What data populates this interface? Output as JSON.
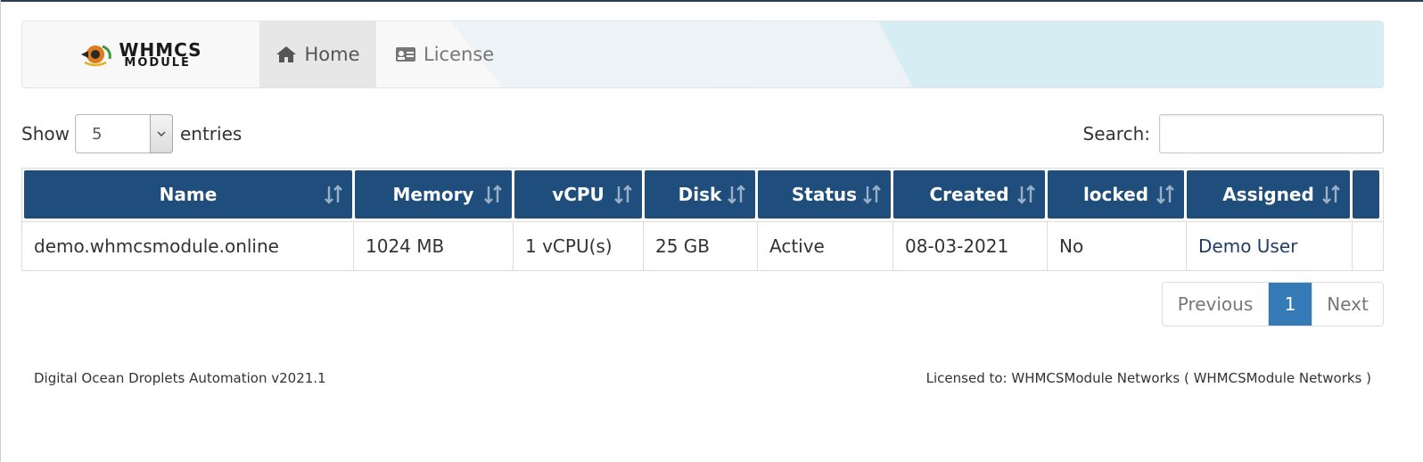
{
  "colors": {
    "header_bg": "#1f4e7d",
    "active_page": "#337ab7",
    "nav_active_bg": "#e7e7e7",
    "nav_accent": "#d6edf3"
  },
  "navbar": {
    "logo_text_top": "WHMCS",
    "logo_text_bottom": "MODULE",
    "items": [
      {
        "label": "Home",
        "icon": "home-icon",
        "active": true
      },
      {
        "label": "License",
        "icon": "id-card-icon",
        "active": false
      }
    ]
  },
  "controls": {
    "show_label": "Show",
    "entries_value": "5",
    "entries_label": "entries",
    "search_label": "Search:",
    "search_value": ""
  },
  "table": {
    "columns": [
      "Name",
      "Memory",
      "vCPU",
      "Disk",
      "Status",
      "Created",
      "locked",
      "Assigned",
      ""
    ],
    "rows": [
      {
        "name": "demo.whmcsmodule.online",
        "memory": "1024 MB",
        "vcpu": "1 vCPU(s)",
        "disk": "25 GB",
        "status": "Active",
        "created": "08-03-2021",
        "locked": "No",
        "assigned": "Demo User",
        "extra": ""
      }
    ]
  },
  "pagination": {
    "previous": "Previous",
    "current": "1",
    "next": "Next"
  },
  "footer": {
    "left": "Digital Ocean Droplets Automation v2021.1",
    "right": "Licensed to: WHMCSModule Networks ( WHMCSModule Networks )"
  }
}
